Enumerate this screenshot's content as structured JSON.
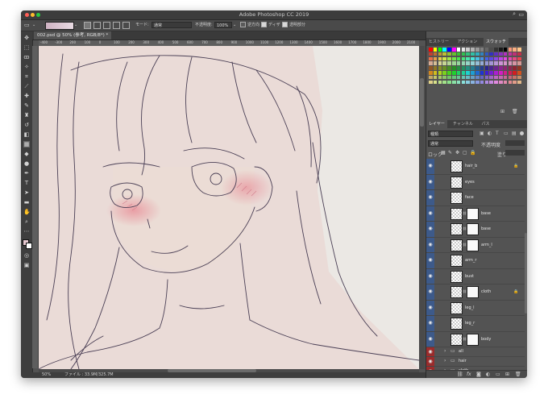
{
  "app": {
    "title": "Adobe Photoshop CC 2019"
  },
  "options_bar": {
    "mode_label": "モード:",
    "mode_value": "通常",
    "opacity_label": "不透明度:",
    "opacity_value": "100%",
    "reverse_label": "逆方向",
    "dither_label": "ディザ",
    "transparency_label": "透明部分"
  },
  "document": {
    "tab_title": "002.psd @ 50% (参考, RGB/8*) *",
    "zoom": "50%",
    "file_info": "ファイル : 33.9M/325.7M",
    "ruler_ticks": [
      "-400",
      "-300",
      "200",
      "100",
      "0",
      "100",
      "200",
      "300",
      "400",
      "500",
      "600",
      "700",
      "800",
      "900",
      "1000",
      "1100",
      "1200",
      "1300",
      "1400",
      "1500",
      "1600",
      "1700",
      "1800",
      "1900",
      "2000",
      "2100"
    ]
  },
  "swatch_panel": {
    "tabs": [
      "ヒストリー",
      "アクション",
      "スウォッチ"
    ],
    "active_tab": "スウォッチ"
  },
  "layers_panel": {
    "tabs": [
      "レイヤー",
      "チャンネル",
      "パス"
    ],
    "active_tab": "レイヤー",
    "kind_filter": "種類",
    "blend_mode": "通常",
    "opacity_label": "不透明度",
    "lock_label": "ロック",
    "fill_label": "塗り",
    "layers": [
      {
        "name": "hair_b",
        "mask": false,
        "locked": true
      },
      {
        "name": "eyes",
        "mask": false,
        "locked": false
      },
      {
        "name": "face",
        "mask": false,
        "locked": false
      },
      {
        "name": "base",
        "mask": true,
        "locked": false
      },
      {
        "name": "base",
        "mask": true,
        "locked": false
      },
      {
        "name": "arm_l",
        "mask": true,
        "locked": false
      },
      {
        "name": "arm_r",
        "mask": false,
        "locked": false
      },
      {
        "name": "bust",
        "mask": false,
        "locked": false
      },
      {
        "name": "cloth",
        "mask": true,
        "locked": true
      },
      {
        "name": "leg_l",
        "mask": false,
        "locked": false
      },
      {
        "name": "leg_r",
        "mask": false,
        "locked": false
      },
      {
        "name": "body",
        "mask": true,
        "locked": false
      }
    ],
    "groups": [
      "all",
      "hair",
      "cloth"
    ],
    "footer_icons": [
      "link-icon",
      "fx-icon",
      "mask-icon",
      "adjustment-icon",
      "folder-icon",
      "new-layer-icon",
      "trash-icon"
    ]
  },
  "colors": {
    "panel_bg": "#535353",
    "visible_blue": "#3d5a8a",
    "hidden_red": "#9b2c2c",
    "blush": "#e88a95",
    "line": "#4a3f55"
  }
}
